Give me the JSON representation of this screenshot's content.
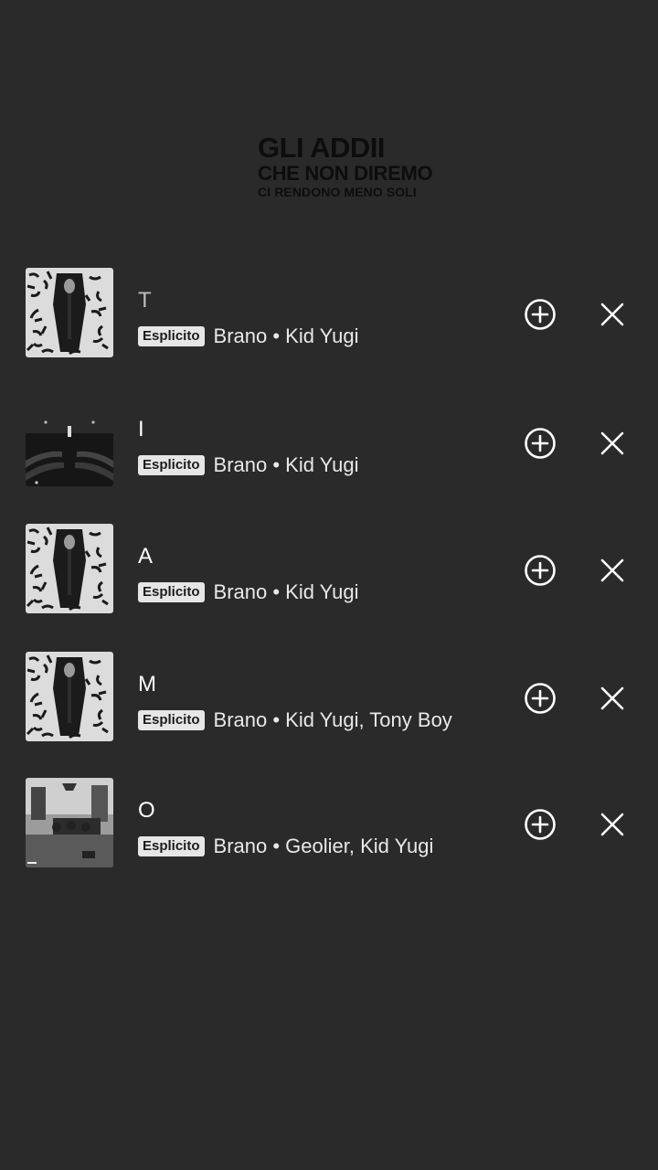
{
  "header": {
    "line1": "GLI ADDII",
    "line2": "CHE NON DIREMO",
    "line3": "CI RENDONO MENO SOLI"
  },
  "rows": [
    {
      "title": "T",
      "badge": "Esplicito",
      "subtitle": "Brano • Kid Yugi",
      "art": "coffin-art"
    },
    {
      "title": "I",
      "badge": "Esplicito",
      "subtitle": "Brano • Kid Yugi",
      "art": "dark-hall-art"
    },
    {
      "title": "A",
      "badge": "Esplicito",
      "subtitle": "Brano • Kid Yugi",
      "art": "coffin-art"
    },
    {
      "title": "M",
      "badge": "Esplicito",
      "subtitle": "Brano • Kid Yugi, Tony Boy",
      "art": "coffin-art"
    },
    {
      "title": "O",
      "badge": "Esplicito",
      "subtitle": "Brano • Geolier, Kid Yugi",
      "art": "room-photo-art"
    }
  ],
  "icons": {
    "add": "add-circle-icon",
    "remove": "close-icon"
  },
  "colors": {
    "background": "#2a2a2a",
    "badge_bg": "#e6e6e6",
    "header_text": "#0d0d0d"
  }
}
